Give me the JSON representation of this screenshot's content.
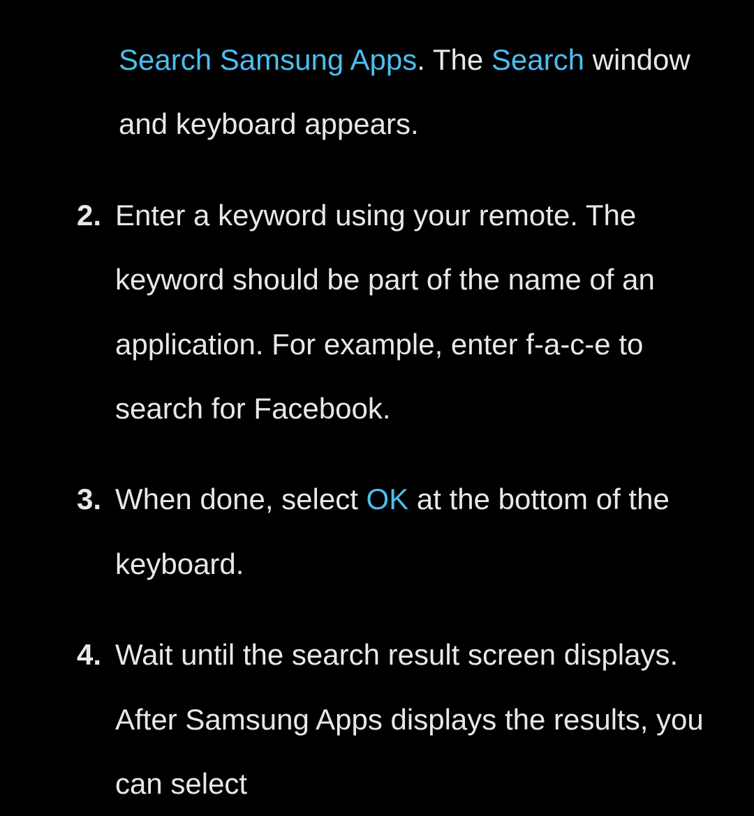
{
  "item1": {
    "highlight1": "Search Samsung Apps",
    "text1": ". The ",
    "highlight2": "Search",
    "text2": " window and keyboard appears."
  },
  "item2": {
    "number": "2.",
    "text": "Enter a keyword using your remote. The keyword should be part of the name of an application. For example, enter f-a-c-e to search for Facebook."
  },
  "item3": {
    "number": "3.",
    "textBefore": "When done, select ",
    "highlight": "OK",
    "textAfter": " at the bottom of the keyboard."
  },
  "item4": {
    "number": "4.",
    "text": "Wait until the search result screen displays. After Samsung Apps displays the results, you can select"
  }
}
